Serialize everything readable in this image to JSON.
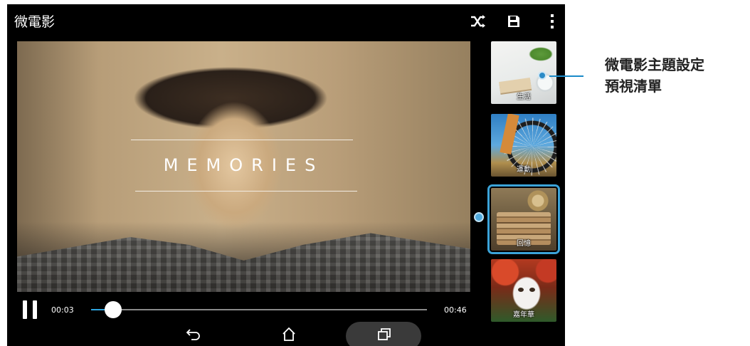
{
  "app": {
    "title": "微電影"
  },
  "toolbar": {
    "shuffle_icon": "shuffle-icon",
    "save_icon": "save-icon",
    "menu_icon": "more-vert-icon"
  },
  "video": {
    "overlay_text": "MEMORIES"
  },
  "playback": {
    "state": "playing",
    "current_time": "00:03",
    "total_time": "00:46",
    "progress": 0.065,
    "accent_color": "#2ea4df"
  },
  "themes": [
    {
      "label": "生活",
      "selected": false
    },
    {
      "label": "運動",
      "selected": false
    },
    {
      "label": "回憶",
      "selected": true
    },
    {
      "label": "嘉年華",
      "selected": false
    }
  ],
  "annotation": {
    "line1": "微電影主題設定",
    "line2": "預視清單",
    "color": "#1a8ac8"
  },
  "navbar": {
    "back_icon": "back-icon",
    "home_icon": "home-icon",
    "recents_icon": "recent-apps-icon"
  }
}
